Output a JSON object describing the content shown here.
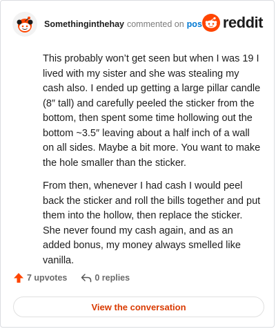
{
  "comment": {
    "username": "Somethinginthehay",
    "action_text": "commented on",
    "post_link": "post",
    "brand": "reddit",
    "paragraphs": [
      "This probably won’t get seen but when I was 19 I lived with my sister and she was stealing my cash also. I ended up getting a large pillar candle (8″ tall) and carefully peeled the sticker from the bottom, then spent some time hollowing out the bottom ~3.5″ leaving about a half inch of a wall on all sides. Maybe a bit more. You want to make the hole smaller than the sticker.",
      "From then, whenever I had cash I would peel back the sticker and roll the bills together and put them into the hollow, then replace the sticker. She never found my cash again, and as an added bonus, my money always smelled like vanilla."
    ],
    "upvotes_label": "7 upvotes",
    "replies_label": "0 replies",
    "view_button_label": "View the conversation"
  },
  "colors": {
    "accent": "#d93a00",
    "upvote": "#ff4500",
    "link": "#0079d3"
  },
  "icons": {
    "avatar": "snoo-avatar",
    "brand": "reddit-logo-icon",
    "upvote": "upvote-arrow-icon",
    "reply": "reply-arrow-icon"
  }
}
